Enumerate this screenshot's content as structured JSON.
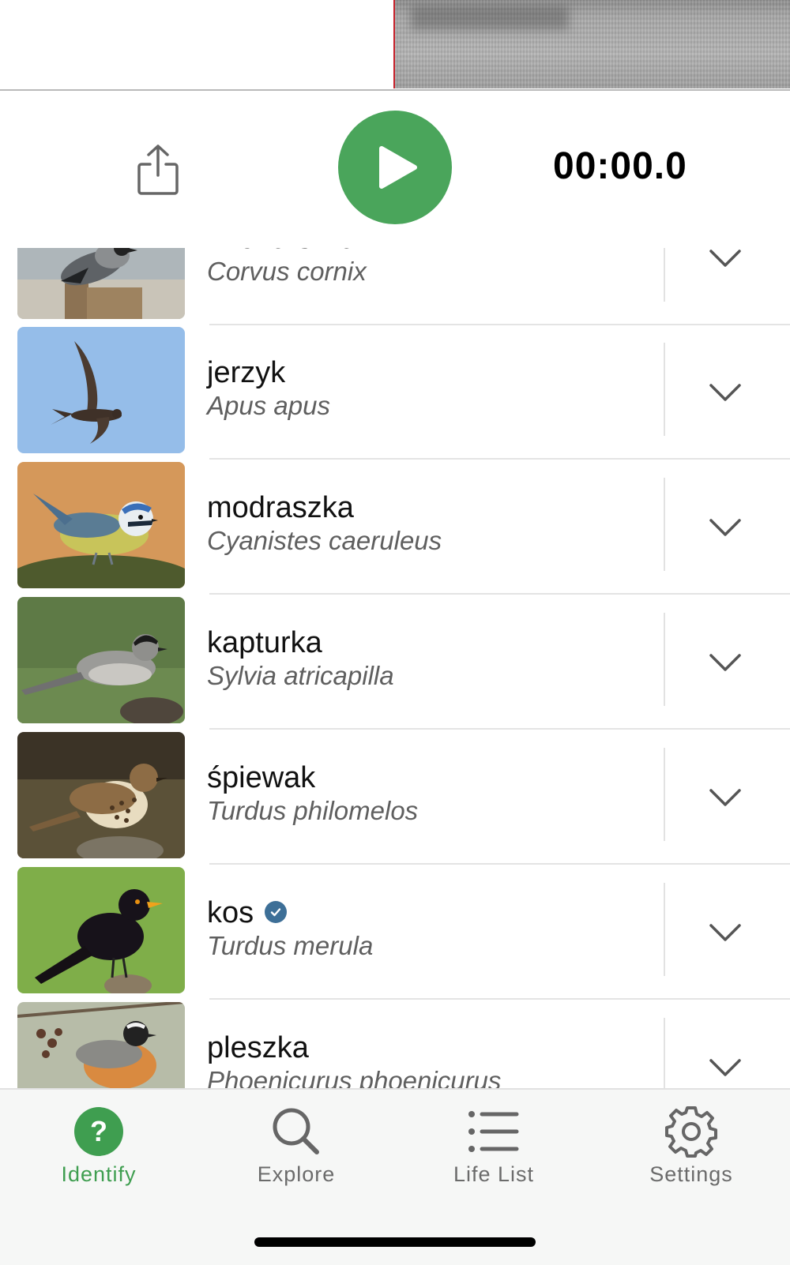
{
  "player": {
    "timer": "00:00.0",
    "colors": {
      "play": "#4aa55b",
      "playhead": "#c6202a"
    },
    "icons": [
      "share-icon",
      "play-icon"
    ]
  },
  "results": [
    {
      "common": "wrona siwa",
      "scientific": "Corvus cornix",
      "verified": false
    },
    {
      "common": "jerzyk",
      "scientific": "Apus apus",
      "verified": false
    },
    {
      "common": "modraszka",
      "scientific": "Cyanistes caeruleus",
      "verified": false
    },
    {
      "common": "kapturka",
      "scientific": "Sylvia atricapilla",
      "verified": false
    },
    {
      "common": "śpiewak",
      "scientific": "Turdus philomelos",
      "verified": false
    },
    {
      "common": "kos",
      "scientific": "Turdus merula",
      "verified": true
    },
    {
      "common": "pleszka",
      "scientific": "Phoenicurus phoenicurus",
      "verified": false
    }
  ],
  "tabs": [
    {
      "label": "Identify",
      "icon": "question-circle-icon",
      "active": true
    },
    {
      "label": "Explore",
      "icon": "search-icon",
      "active": false
    },
    {
      "label": "Life List",
      "icon": "list-icon",
      "active": false
    },
    {
      "label": "Settings",
      "icon": "gear-icon",
      "active": false
    }
  ],
  "accent": "#3f9e50"
}
